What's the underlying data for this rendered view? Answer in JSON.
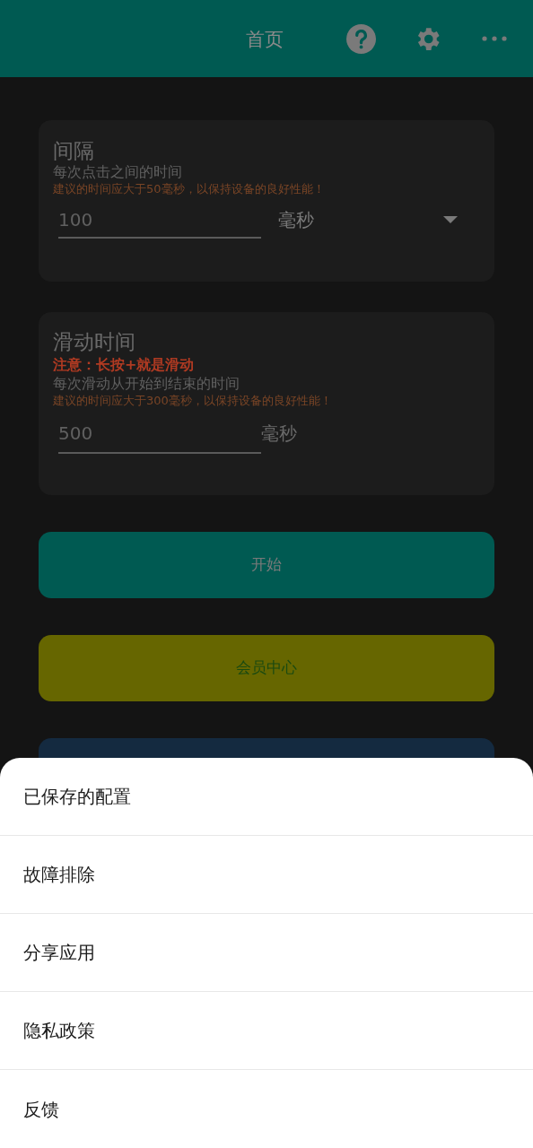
{
  "app_bar": {
    "title": "首页"
  },
  "interval_card": {
    "title": "间隔",
    "description": "每次点击之间的时间",
    "warning": "建议的时间应大于50毫秒，以保持设备的良好性能！",
    "value": "100",
    "unit": "毫秒"
  },
  "swipe_card": {
    "title": "滑动时间",
    "note": "注意：长按+就是滑动",
    "description": "每次滑动从开始到结束的时间",
    "warning": "建议的时间应大于300毫秒，以保持设备的良好性能！",
    "value": "500",
    "unit": "毫秒"
  },
  "buttons": [
    {
      "label": "开始",
      "color": "#005a52"
    },
    {
      "label": "会员中心",
      "color": "#666600"
    },
    {
      "color": "#142a40"
    }
  ],
  "menu": [
    "已保存的配置",
    "故障排除",
    "分享应用",
    "隐私政策",
    "反馈"
  ]
}
